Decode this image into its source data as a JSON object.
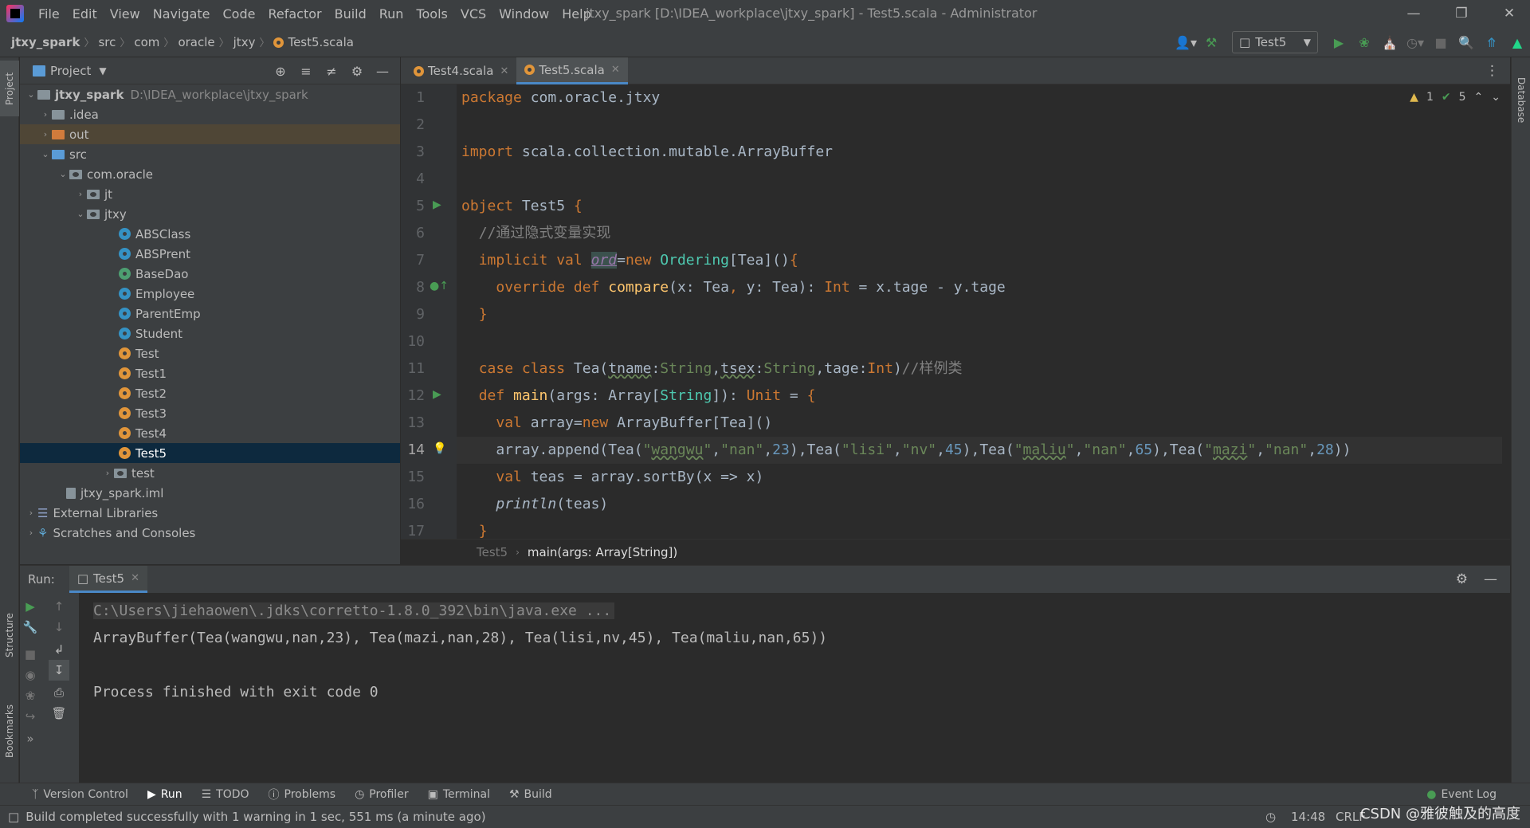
{
  "menu": [
    "File",
    "Edit",
    "View",
    "Navigate",
    "Code",
    "Refactor",
    "Build",
    "Run",
    "Tools",
    "VCS",
    "Window",
    "Help"
  ],
  "window_title": "jtxy_spark [D:\\IDEA_workplace\\jtxy_spark] - Test5.scala - Administrator",
  "breadcrumbs": [
    "jtxy_spark",
    "src",
    "com",
    "oracle",
    "jtxy",
    "Test5.scala"
  ],
  "run_config": "Test5",
  "project_panel": {
    "title": "Project",
    "tree": [
      {
        "label": "jtxy_spark",
        "path": "D:\\IDEA_workplace\\jtxy_spark"
      },
      {
        "label": ".idea"
      },
      {
        "label": "out"
      },
      {
        "label": "src"
      },
      {
        "label": "com.oracle"
      },
      {
        "label": "jt"
      },
      {
        "label": "jtxy"
      },
      {
        "label": "ABSClass"
      },
      {
        "label": "ABSPrent"
      },
      {
        "label": "BaseDao"
      },
      {
        "label": "Employee"
      },
      {
        "label": "ParentEmp"
      },
      {
        "label": "Student"
      },
      {
        "label": "Test"
      },
      {
        "label": "Test1"
      },
      {
        "label": "Test2"
      },
      {
        "label": "Test3"
      },
      {
        "label": "Test4"
      },
      {
        "label": "Test5"
      },
      {
        "label": "test"
      },
      {
        "label": "jtxy_spark.iml"
      },
      {
        "label": "External Libraries"
      },
      {
        "label": "Scratches and Consoles"
      }
    ]
  },
  "editor": {
    "tabs": [
      "Test4.scala",
      "Test5.scala"
    ],
    "line_numbers": [
      "1",
      "2",
      "3",
      "4",
      "5",
      "6",
      "7",
      "8",
      "9",
      "10",
      "11",
      "12",
      "13",
      "14",
      "15",
      "16",
      "17"
    ],
    "inspections": {
      "warnings": "1",
      "ok": "5"
    },
    "breadcrumb": [
      "Test5",
      "main(args: Array[String])"
    ]
  },
  "run_panel": {
    "label": "Run:",
    "tab": "Test5",
    "console": [
      "C:\\Users\\jiehaowen\\.jdks\\corretto-1.8.0_392\\bin\\java.exe ...",
      "ArrayBuffer(Tea(wangwu,nan,23), Tea(mazi,nan,28), Tea(lisi,nv,45), Tea(maliu,nan,65))",
      "",
      "Process finished with exit code 0"
    ]
  },
  "side_tabs": {
    "left": [
      "Project",
      "Structure",
      "Bookmarks"
    ],
    "right": [
      "Database"
    ]
  },
  "bottom_tabs": [
    "Version Control",
    "Run",
    "TODO",
    "Problems",
    "Profiler",
    "Terminal",
    "Build"
  ],
  "event_log": "Event Log",
  "status": {
    "message": "Build completed successfully with 1 warning in 1 sec, 551 ms (a minute ago)",
    "time": "14:48",
    "encoding": "CRLF",
    "watermark": "CSDN @雅彼触及的高度"
  }
}
